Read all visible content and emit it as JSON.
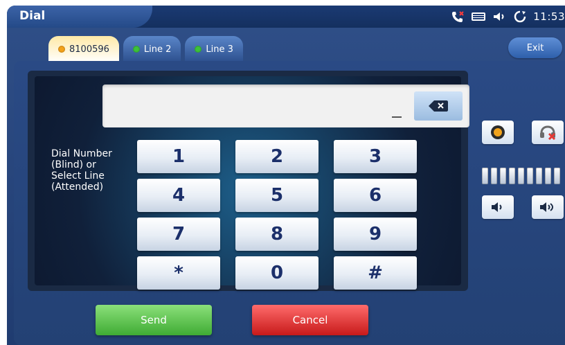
{
  "app": {
    "title": "Dial"
  },
  "status_bar": {
    "time": "11:53",
    "icons": [
      "missed-call-icon",
      "keyboard-icon",
      "volume-icon",
      "sync-icon"
    ]
  },
  "tabs": [
    {
      "label": "8100596",
      "status_color": "#f4a21a",
      "active": true
    },
    {
      "label": "Line 2",
      "status_color": "#3dc23b",
      "active": false
    },
    {
      "label": "Line 3",
      "status_color": "#3dc23b",
      "active": false
    }
  ],
  "actions": {
    "exit_label": "Exit",
    "send_label": "Send",
    "cancel_label": "Cancel"
  },
  "dialer": {
    "input_value": "",
    "instructions": "Dial Number (Blind) or Select Line (Attended)",
    "keys": [
      "1",
      "2",
      "3",
      "4",
      "5",
      "6",
      "7",
      "8",
      "9",
      "*",
      "0",
      "#"
    ]
  },
  "side_controls": {
    "record_icon": "record-icon",
    "mute_icon": "mute-headset-icon",
    "volume_down_icon": "volume-down-icon",
    "volume_up_icon": "volume-up-icon",
    "volume_level_segments": 9
  },
  "colors": {
    "frame_blue": "#203c70",
    "send_green": "#3fab34",
    "cancel_red": "#c71a1a",
    "active_tab": "#ffe9a6"
  }
}
